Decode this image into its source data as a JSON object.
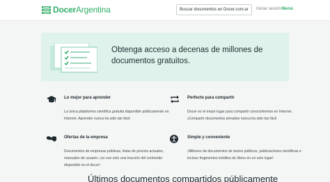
{
  "header": {
    "logo_bold": "Docer",
    "logo_rest": "Argentina",
    "search_value": "Buscar documentos en Docer.com.ar",
    "login_label": "Iniciar sesión",
    "menu_label": "Menú"
  },
  "banner": {
    "headline": "Obtenga acceso a decenas de millones de documentos gratuitos."
  },
  "features": [
    {
      "icon": "graduation-cap-icon",
      "title": "Lo mejor para aprender",
      "description": "La única plataforma científica gratuita disponible públicamente en Internet. Aprender nunca ha sido tan fácil"
    },
    {
      "icon": "share-arrows-icon",
      "title": "Perfecto para compartir",
      "description": "Docer es el mejor lugar para compartir conocimientos en Internet. ¡Compartir documentos privados nunca ha sido tan fácil"
    },
    {
      "icon": "handshake-icon",
      "title": "Ofertas de la empresa",
      "description": "Documentos de empresas públicas, listas de precios actuales, manuales de usuario: ¡no son solo una fracción del contenido disponible en el docer!"
    },
    {
      "icon": "accessibility-icon",
      "title": "Simple y conveniente",
      "description": "¡Millones de documentos de textos públicos, publicaciones científicas e incluso fragmentos inéditos de libros en un solo lugar!"
    }
  ],
  "bottom": {
    "title": "Últimos documentos compartidos públicamente"
  },
  "colors": {
    "brand_green": "#2fae66",
    "banner_bg": "#dff3ec",
    "page_bg": "#f4f5f5"
  }
}
